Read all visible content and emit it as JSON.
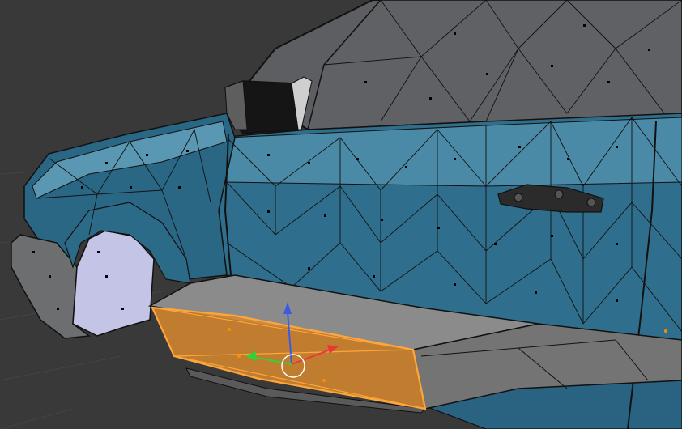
{
  "viewport": {
    "mode": "Edit Mode",
    "selection": "face"
  },
  "colors": {
    "background": "#393939",
    "grid_line": "#4a4a4a",
    "car_body": "#2e6e8c",
    "car_body_light": "#4f8fab",
    "car_body_dark": "#1e4f68",
    "glass": "#5e6063",
    "wire": "#111111",
    "wheel_well": "#c8c8e8",
    "skirt": "#8a8a8a",
    "skirt_dark": "#6e6e6e",
    "selected_face": "#d98a2e",
    "selected_edge": "#ffa63a",
    "gizmo_x": "#e63a3a",
    "gizmo_y": "#35d035",
    "gizmo_z": "#3a5ae6",
    "pivot_ring": "#ffffff"
  },
  "gizmo": {
    "axes": [
      {
        "name": "X",
        "color": "#e63a3a"
      },
      {
        "name": "Y",
        "color": "#35d035"
      },
      {
        "name": "Z",
        "color": "#3a5ae6"
      }
    ]
  }
}
